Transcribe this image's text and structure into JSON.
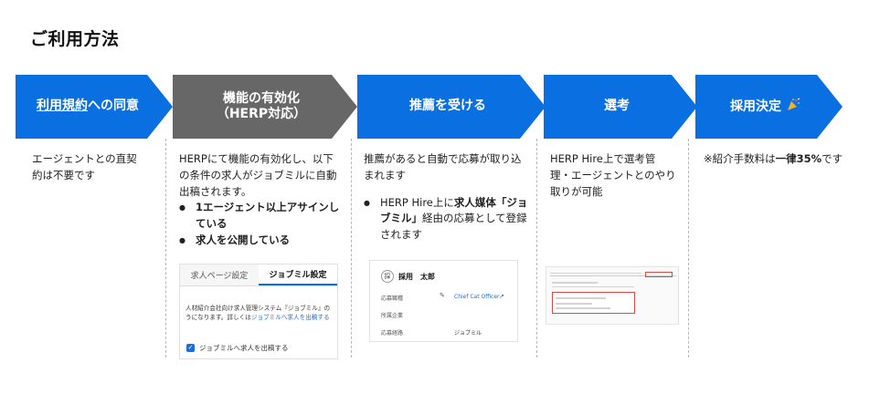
{
  "page_title": "ご利用方法",
  "steps": [
    {
      "label_underlined": "利用規約",
      "label_rest": "への同意"
    },
    {
      "line1": "機能の有効化",
      "line2": "（HERP対応）"
    },
    {
      "label": "推薦を受ける"
    },
    {
      "label": "選考"
    },
    {
      "label": "採用決定",
      "icon": "party-popper-icon"
    }
  ],
  "colors": {
    "blue": "#0a6fe0",
    "gray": "#676767"
  },
  "col1": {
    "text": "エージェントとの直契約は不要です"
  },
  "col2": {
    "intro": "HERPにて機能の有効化し、以下の条件の求人がジョブミルに自動出稿されます。",
    "bullets": [
      "1エージェント以上アサインしている",
      "求人を公開している"
    ]
  },
  "mock1": {
    "tab1": "求人ページ設定",
    "tab2": "ジョブミル設定",
    "desc_a": "人材紹介会社向け求人管理システム『ジョブミル』の",
    "desc_b": "うになります。詳しくは",
    "desc_link": "ジョブミルへ求人を出稿する",
    "checkbox_label": "ジョブミルへ求人を出稿する"
  },
  "col3": {
    "intro": "推薦があると自動で応募が取り込まれます",
    "bullet_pre": "HERP Hire上に",
    "bullet_bold": "求人媒体「ジョブミル」",
    "bullet_post": "経由の応募として登録されます"
  },
  "mock2": {
    "avatar": "採",
    "name": "採用　太郎",
    "row1_label": "応募職種",
    "row1_value": "Chief Cat Officer",
    "row2_label": "所属企業",
    "row3_label": "応募経路",
    "row3_value": "ジョブミル"
  },
  "col4": {
    "text": "HERP Hire上で選考管理・エージェントとのやり取りが可能"
  },
  "col5": {
    "pre": "※紹介手数料は",
    "bold": "一律35%",
    "post": "です"
  }
}
